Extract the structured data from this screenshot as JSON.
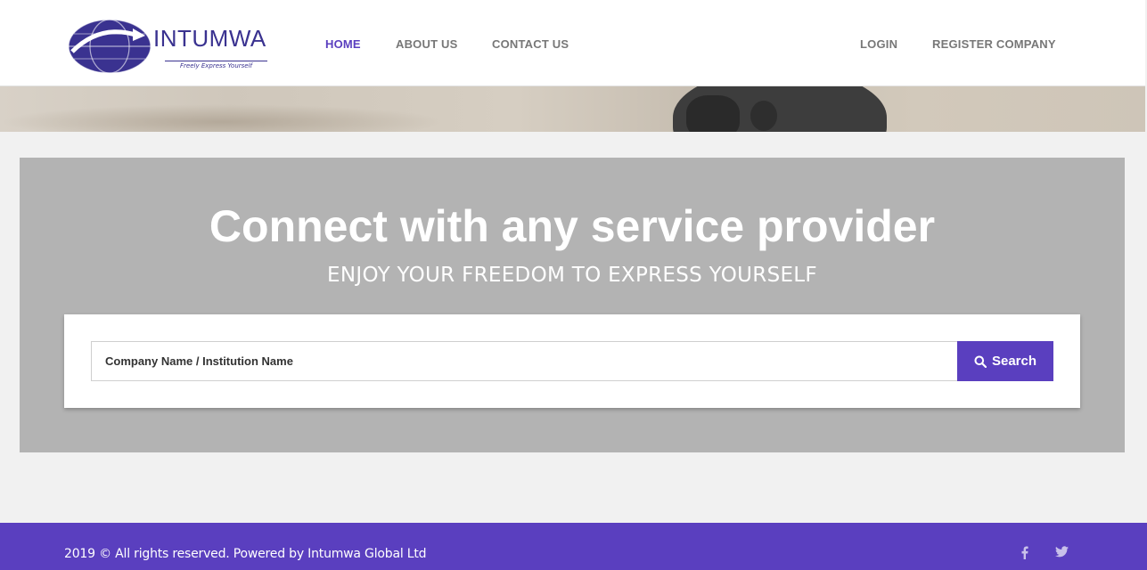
{
  "brand": {
    "name": "INTUMWA",
    "tagline": "Freely Express Yourself",
    "primary_color": "#5a3fbf"
  },
  "nav": {
    "left": [
      {
        "label": "HOME",
        "active": true
      },
      {
        "label": "ABOUT US",
        "active": false
      },
      {
        "label": "CONTACT US",
        "active": false
      }
    ],
    "right": [
      {
        "label": "LOGIN"
      },
      {
        "label": "REGISTER COMPANY"
      }
    ]
  },
  "hero": {
    "title": "Connect with any service provider",
    "subtitle": "ENJOY YOUR FREEDOM TO EXPRESS YOURSELF",
    "search": {
      "placeholder": "Company Name / Institution Name",
      "value": "",
      "button_label": "Search",
      "button_icon": "search-icon"
    }
  },
  "footer": {
    "copyright": "2019 © All rights reserved. Powered by Intumwa Global Ltd",
    "social": [
      {
        "icon": "facebook-icon"
      },
      {
        "icon": "twitter-icon"
      }
    ]
  }
}
